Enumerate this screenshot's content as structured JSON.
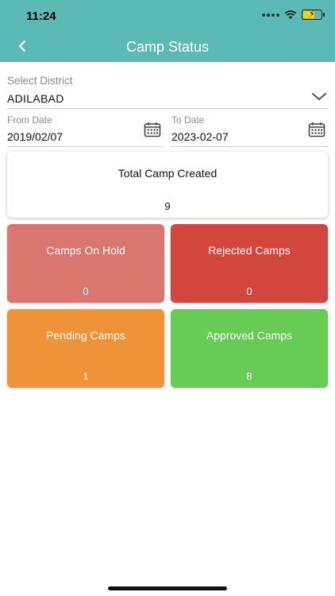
{
  "status_bar": {
    "time": "11:24"
  },
  "header": {
    "title": "Camp Status"
  },
  "district": {
    "label": "Select District",
    "value": "ADILABAD"
  },
  "from_date": {
    "label": "From Date",
    "value": "2019/02/07"
  },
  "to_date": {
    "label": "To Date",
    "value": "2023-02-07"
  },
  "total": {
    "title": "Total Camp Created",
    "value": "9"
  },
  "stats": [
    {
      "title": "Camps On Hold",
      "value": "0",
      "color": "#d9776f"
    },
    {
      "title": "Rejected Camps",
      "value": "0",
      "color": "#d3463e"
    },
    {
      "title": "Pending Camps",
      "value": "1",
      "color": "#f09338"
    },
    {
      "title": "Approved Camps",
      "value": "8",
      "color": "#66cc55"
    }
  ],
  "colors": {
    "header": "#5bbab6"
  }
}
